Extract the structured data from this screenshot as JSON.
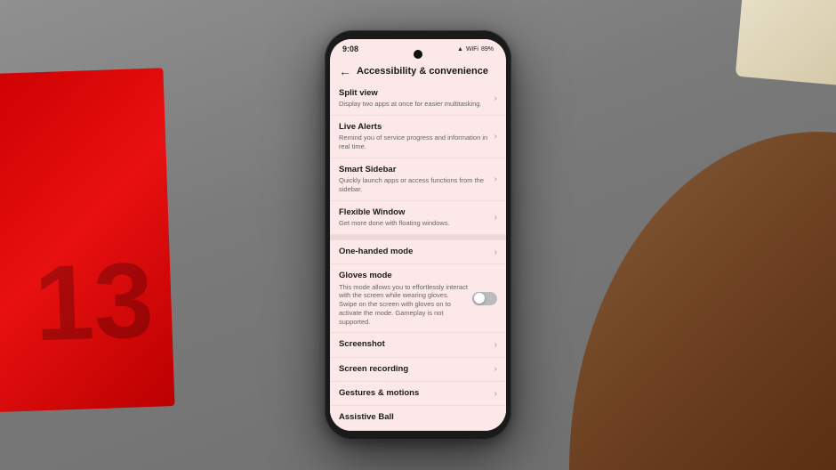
{
  "scene": {
    "background_color": "#888888"
  },
  "phone": {
    "status_bar": {
      "time": "9:08",
      "icons": "▲ ↑ ↓ ▲ 89%"
    },
    "header": {
      "back_label": "←",
      "title": "Accessibility & convenience"
    },
    "settings_items": [
      {
        "id": "split-view",
        "title": "Split view",
        "description": "Display two apps at once for easier multitasking.",
        "has_chevron": true,
        "has_toggle": false,
        "divider_before": false
      },
      {
        "id": "live-alerts",
        "title": "Live Alerts",
        "description": "Remind you of service progress and information in real time.",
        "has_chevron": true,
        "has_toggle": false,
        "divider_before": false
      },
      {
        "id": "smart-sidebar",
        "title": "Smart Sidebar",
        "description": "Quickly launch apps or access functions from the sidebar.",
        "has_chevron": true,
        "has_toggle": false,
        "divider_before": false
      },
      {
        "id": "flexible-window",
        "title": "Flexible Window",
        "description": "Get more done with floating windows.",
        "has_chevron": true,
        "has_toggle": false,
        "divider_before": false
      },
      {
        "id": "one-handed-mode",
        "title": "One-handed mode",
        "description": "",
        "has_chevron": true,
        "has_toggle": false,
        "divider_before": true
      },
      {
        "id": "gloves-mode",
        "title": "Gloves mode",
        "description": "This mode allows you to effortlessly interact with the screen while wearing gloves. Swipe on the screen with gloves on to activate the mode. Gameplay is not supported.",
        "has_chevron": false,
        "has_toggle": true,
        "toggle_on": false,
        "divider_before": false
      },
      {
        "id": "screenshot",
        "title": "Screenshot",
        "description": "",
        "has_chevron": true,
        "has_toggle": false,
        "divider_before": false
      },
      {
        "id": "screen-recording",
        "title": "Screen recording",
        "description": "",
        "has_chevron": true,
        "has_toggle": false,
        "divider_before": false
      },
      {
        "id": "gestures-motions",
        "title": "Gestures & motions",
        "description": "",
        "has_chevron": true,
        "has_toggle": false,
        "divider_before": false
      },
      {
        "id": "assistive-ball",
        "title": "Assistive Ball",
        "description": "",
        "has_chevron": false,
        "has_toggle": false,
        "divider_before": false
      }
    ]
  }
}
